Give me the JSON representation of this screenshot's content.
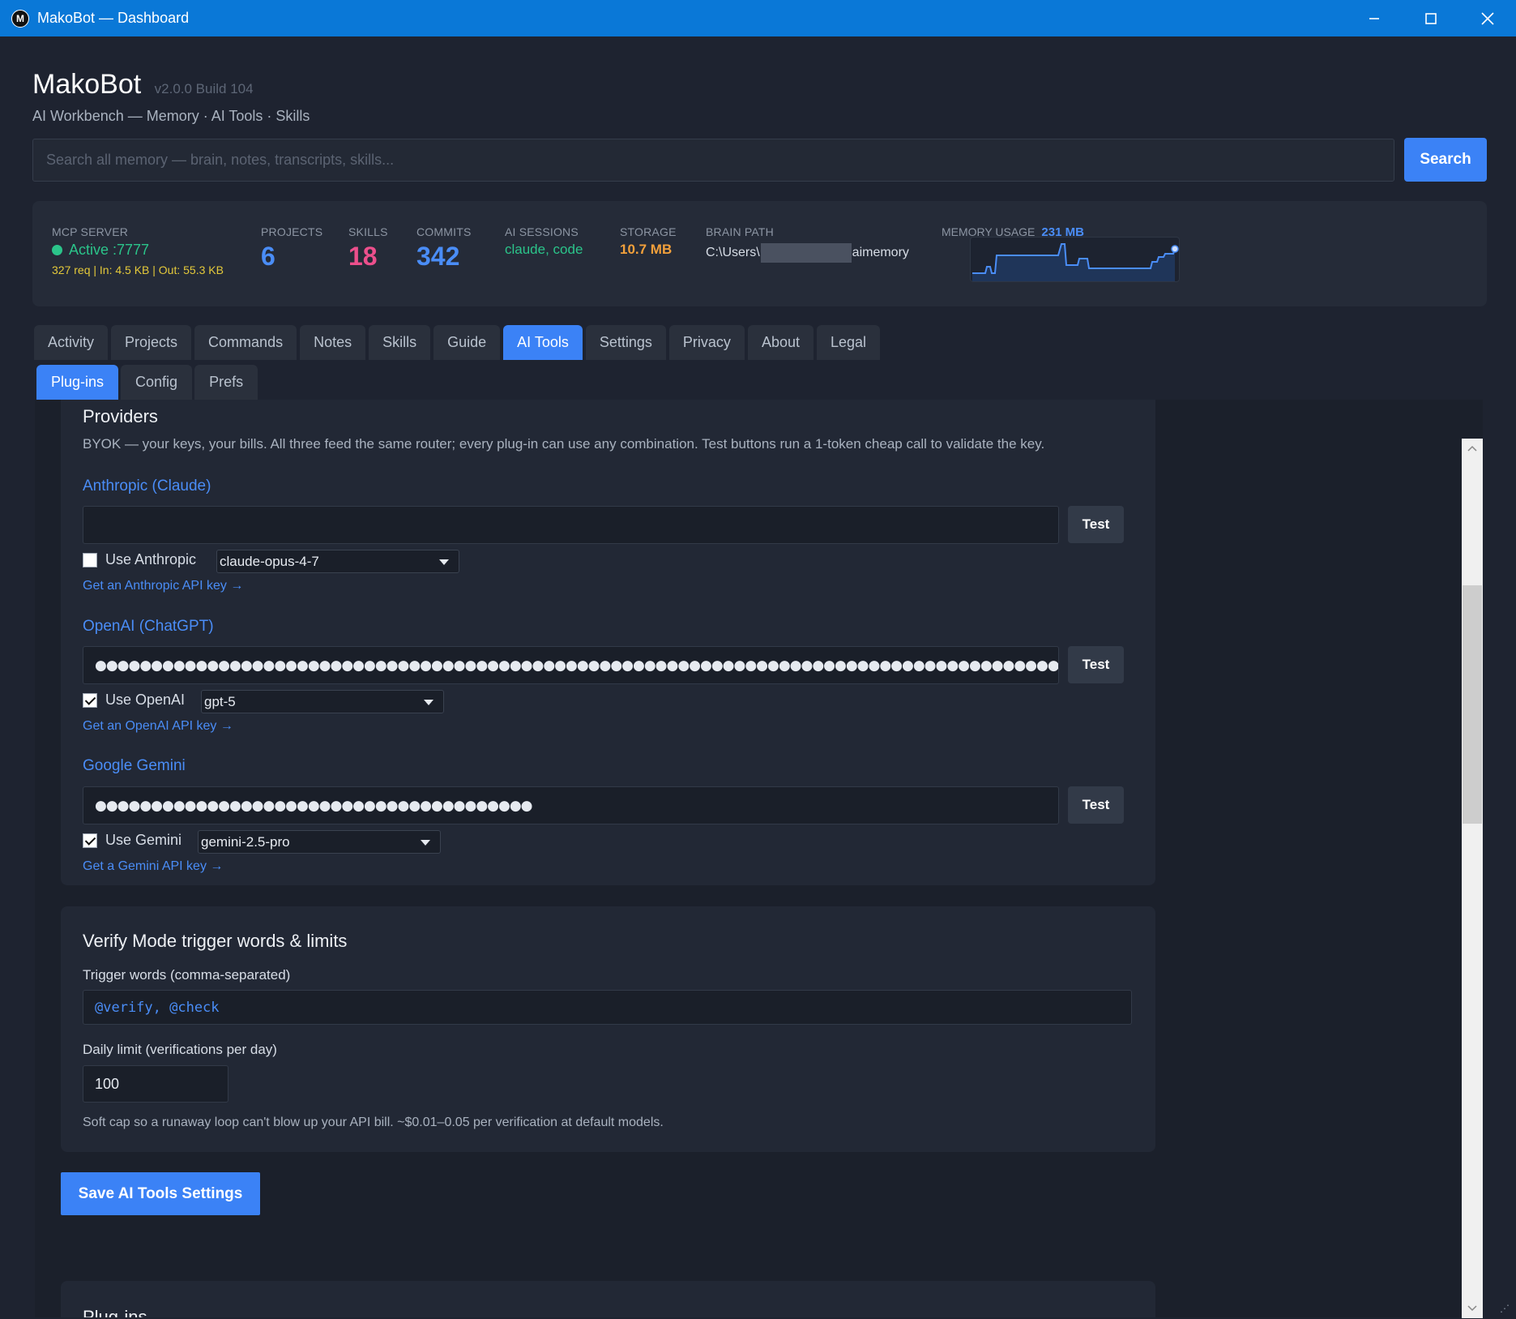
{
  "window": {
    "title": "MakoBot — Dashboard",
    "icon_letter": "M",
    "controls": [
      "minimize-icon",
      "maximize-icon",
      "close-icon"
    ]
  },
  "header": {
    "app_name": "MakoBot",
    "version": "v2.0.0 Build 104",
    "tagline": "AI Workbench — Memory · AI Tools · Skills"
  },
  "search": {
    "placeholder": "Search all memory — brain, notes, transcripts, skills...",
    "button_label": "Search"
  },
  "stats": {
    "mcp": {
      "label": "MCP SERVER",
      "status": "Active :7777",
      "traffic": "327 req | In: 4.5 KB | Out: 55.3 KB"
    },
    "projects": {
      "label": "PROJECTS",
      "value": "6"
    },
    "skills": {
      "label": "SKILLS",
      "value": "18"
    },
    "commits": {
      "label": "COMMITS",
      "value": "342"
    },
    "ai_sessions": {
      "label": "AI SESSIONS",
      "value": "claude, code"
    },
    "storage": {
      "label": "STORAGE",
      "value": "10.7 MB"
    },
    "brain_path": {
      "label": "BRAIN PATH",
      "prefix": "C:\\Users\\",
      "suffix": "aimemory"
    },
    "memory": {
      "label": "MEMORY USAGE",
      "value": "231 MB"
    },
    "colors": {
      "active": "#2bc48a",
      "projects": "#4a8df7",
      "skills": "#ec4f8c",
      "commits": "#4a8df7",
      "storage": "#f2a03b"
    }
  },
  "tabs": [
    "Activity",
    "Projects",
    "Commands",
    "Notes",
    "Skills",
    "Guide",
    "AI Tools",
    "Settings",
    "Privacy",
    "About",
    "Legal"
  ],
  "active_tab": "AI Tools",
  "subtabs": [
    "Plug-ins",
    "Config",
    "Prefs"
  ],
  "active_subtab": "Plug-ins",
  "providers": {
    "title": "Providers",
    "description": "BYOK — your keys, your bills. All three feed the same router; every plug-in can use any combination. Test buttons run a 1-token cheap call to validate the key.",
    "test_label": "Test",
    "anthropic": {
      "name": "Anthropic (Claude)",
      "key": "",
      "use_label": "Use Anthropic",
      "checked": false,
      "model": "claude-opus-4-7",
      "link": "Get an Anthropic API key →"
    },
    "openai": {
      "name": "OpenAI (ChatGPT)",
      "key": "●●●●●●●●●●●●●●●●●●●●●●●●●●●●●●●●●●●●●●●●●●●●●●●●●●●●●●●●●●●●●●●●●●●●●●●●●●●●●●●●●●●●●●●●●●●●●●●●●●●●●●●●●●●●●●●",
      "use_label": "Use OpenAI",
      "checked": true,
      "model": "gpt-5",
      "link": "Get an OpenAI API key →"
    },
    "gemini": {
      "name": "Google Gemini",
      "key": "●●●●●●●●●●●●●●●●●●●●●●●●●●●●●●●●●●●●●●●",
      "use_label": "Use Gemini",
      "checked": true,
      "model": "gemini-2.5-pro",
      "link": "Get a Gemini API key →"
    }
  },
  "verify": {
    "title": "Verify Mode trigger words & limits",
    "trigger_label": "Trigger words (comma-separated)",
    "trigger_value": "@verify, @check",
    "limit_label": "Daily limit (verifications per day)",
    "limit_value": "100",
    "hint": "Soft cap so a runaway loop can't blow up your API bill. ~$0.01–0.05 per verification at default models."
  },
  "save_label": "Save AI Tools Settings",
  "plugins_title": "Plug-ins"
}
